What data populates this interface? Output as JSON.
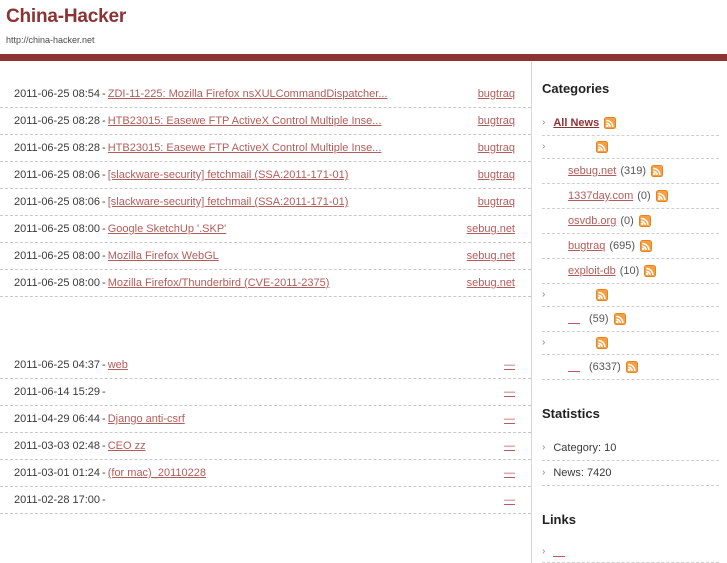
{
  "header": {
    "title": "China-Hacker",
    "url": "http://china-hacker.net"
  },
  "news": {
    "group1": [
      {
        "date": "2011-06-25 08:54",
        "sep": "-",
        "title": "ZDI-11-225: Mozilla Firefox nsXULCommandDispatcher...",
        "source": "bugtraq"
      },
      {
        "date": "2011-06-25 08:28",
        "sep": "-",
        "title": "HTB23015: Easewe FTP ActiveX Control Multiple Inse...",
        "source": "bugtraq"
      },
      {
        "date": "2011-06-25 08:28",
        "sep": "-",
        "title": "HTB23015: Easewe FTP ActiveX Control Multiple Inse...",
        "source": "bugtraq"
      },
      {
        "date": "2011-06-25 08:06",
        "sep": "-",
        "title": "[slackware-security] fetchmail (SSA:2011-171-01)",
        "source": "bugtraq"
      },
      {
        "date": "2011-06-25 08:06",
        "sep": "-",
        "title": "[slackware-security] fetchmail (SSA:2011-171-01)",
        "source": "bugtraq"
      },
      {
        "date": "2011-06-25 08:00",
        "sep": "-",
        "title": "Google SketchUp '.SKP'          ",
        "source": "sebug.net"
      },
      {
        "date": "2011-06-25 08:00",
        "sep": "-",
        "title": "Mozilla Firefox WebGL       ",
        "source": "sebug.net"
      },
      {
        "date": "2011-06-25 08:00",
        "sep": "-",
        "title": "Mozilla Firefox/Thunderbird       (CVE-2011-2375)",
        "source": "sebug.net"
      }
    ],
    "group2": [
      {
        "date": "2011-06-25 04:37",
        "sep": "-",
        "title": "  web     ",
        "source": "—"
      },
      {
        "date": "2011-06-14 15:29",
        "sep": "-",
        "title": "        ",
        "source": "—"
      },
      {
        "date": "2011-04-29 06:44",
        "sep": "-",
        "title": "  Django anti-csrf      ",
        "source": "—"
      },
      {
        "date": "2011-03-03 02:48",
        "sep": "-",
        "title": "      CEO      zz",
        "source": "—"
      },
      {
        "date": "2011-03-01 01:24",
        "sep": "-",
        "title": "     (for mac)_20110228",
        "source": "—"
      },
      {
        "date": "2011-02-28 17:00",
        "sep": "-",
        "title": "           ",
        "source": "—"
      }
    ]
  },
  "sidebar": {
    "categories_heading": "Categories",
    "categories": [
      {
        "label": "All News",
        "strong": true,
        "count": null,
        "indent": false,
        "rss": true,
        "chevron": true
      },
      {
        "label": "",
        "strong": false,
        "count": null,
        "indent": false,
        "rss": true,
        "chevron": true
      },
      {
        "label": "sebug.net",
        "strong": false,
        "count": "(319)",
        "indent": true,
        "rss": true,
        "chevron": false
      },
      {
        "label": "1337day.com",
        "strong": false,
        "count": "(0)",
        "indent": true,
        "rss": true,
        "chevron": false
      },
      {
        "label": "osvdb.org",
        "strong": false,
        "count": "(0)",
        "indent": true,
        "rss": true,
        "chevron": false
      },
      {
        "label": "bugtraq",
        "strong": false,
        "count": "(695)",
        "indent": true,
        "rss": true,
        "chevron": false
      },
      {
        "label": "exploit-db",
        "strong": false,
        "count": "(10)",
        "indent": true,
        "rss": true,
        "chevron": false
      },
      {
        "label": "",
        "strong": false,
        "count": null,
        "indent": false,
        "rss": true,
        "chevron": true
      },
      {
        "label": "",
        "strong": false,
        "count": "(59)",
        "indent": true,
        "rss": true,
        "chevron": false
      },
      {
        "label": "",
        "strong": false,
        "count": null,
        "indent": false,
        "rss": true,
        "chevron": true
      },
      {
        "label": "",
        "strong": false,
        "count": "(6337)",
        "indent": true,
        "rss": true,
        "chevron": false
      }
    ],
    "statistics_heading": "Statistics",
    "statistics": [
      {
        "label": "Category: 10"
      },
      {
        "label": "News: 7420"
      }
    ],
    "links_heading": "Links",
    "links": [
      {
        "label": ""
      }
    ]
  },
  "colors": {
    "brand": "#8C3333",
    "link": "#b45c5c",
    "rss_orange": "#f49038",
    "text": "#3a3a3a"
  }
}
